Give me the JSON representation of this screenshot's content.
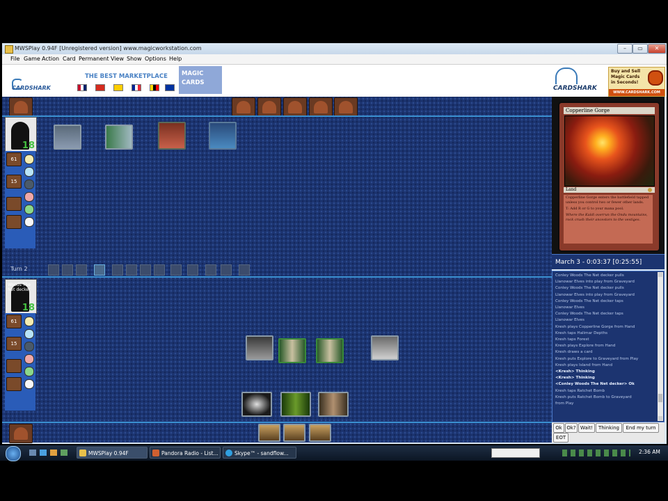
{
  "window": {
    "title": "MWSPlay 0.94F [Unregistered version]   www.magicworkstation.com",
    "controls": [
      "–",
      "▭",
      "✕"
    ]
  },
  "menubar": [
    "File",
    "Game",
    "Action",
    "Card",
    "Permanent",
    "View",
    "Show",
    "Options",
    "Help"
  ],
  "ad": {
    "logo": "CARDSHARK",
    "headline": "THE BEST MARKETPLACE",
    "tag": "MAGIC CARDS",
    "right_logo": "CARDSHARK",
    "promo_line1": "Buy and Sell",
    "promo_line2": "Magic Cards",
    "promo_line3": "in Seconds!",
    "promo_url": "WWW.CARDSHARK.COM"
  },
  "board": {
    "turn_label": "Turn 2",
    "opponent": {
      "life": "18"
    },
    "player": {
      "life": "18",
      "avatar_text": "Woods The Net decker"
    },
    "zones": [
      "61",
      "15",
      "",
      ""
    ]
  },
  "preview": {
    "name": "Copperline Gorge",
    "type": "Land",
    "text1": "Copperline Gorge enters the battlefield tapped unless you control two or fewer other lands.",
    "text2": "T: Add R or G to your mana pool.",
    "flavor": "Where the Kuldi overrun the Ondu mountains, rock crush their ancestors to the vestiges."
  },
  "date_bar": "March 3 - 0:03:37 [0:25:55]",
  "log": [
    {
      "t": "Conley Woods The Net decker pulls",
      "b": false
    },
    {
      "t": "Llanowar Elves into play from Graveyard",
      "b": false
    },
    {
      "t": "Conley Woods The Net decker pulls",
      "b": false
    },
    {
      "t": "Llanowar Elves into play from Graveyard",
      "b": false
    },
    {
      "t": "Conley Woods The Net decker taps",
      "b": false
    },
    {
      "t": "Llanowar Elves",
      "b": false
    },
    {
      "t": "Conley Woods The Net decker taps",
      "b": false
    },
    {
      "t": "Llanowar Elves",
      "b": false
    },
    {
      "t": "Kresh plays Copperline Gorge from Hand",
      "b": false
    },
    {
      "t": "Kresh taps Halimar Depths",
      "b": false
    },
    {
      "t": "Kresh taps Forest",
      "b": false
    },
    {
      "t": "Kresh plays Explore from Hand",
      "b": false
    },
    {
      "t": "Kresh draws a card",
      "b": false
    },
    {
      "t": "Kresh puts Explore to Graveyard from Play",
      "b": false
    },
    {
      "t": "Kresh plays Island from Hand",
      "b": false
    },
    {
      "t": "<Kresh> Thinking",
      "b": true
    },
    {
      "t": "<Kresh> Thinking",
      "b": true
    },
    {
      "t": "<Conley Woods The Net decker> Ok",
      "b": true
    },
    {
      "t": "Kresh taps Ratchet Bomb",
      "b": false
    },
    {
      "t": "Kresh puts Ratchet Bomb to Graveyard",
      "b": false
    },
    {
      "t": "from Play",
      "b": false
    }
  ],
  "chat_buttons": [
    "Ok",
    "Ok?",
    "Wait!",
    "Thinking",
    "End my turn",
    "EOT"
  ],
  "taskbar": {
    "items": [
      "MWSPlay 0.94F",
      "Pandora Radio - List...",
      "Skype™ - sandflow..."
    ],
    "clock": "2:36 AM"
  },
  "colors": {
    "board": "#1c3470",
    "divider": "#3a8fd0",
    "life": "#44c040",
    "mana": [
      "#f5ecb0",
      "#b8e4f8",
      "#4a5a6a",
      "#f0a8a8",
      "#8ad88a",
      "#f8f8f8"
    ]
  }
}
